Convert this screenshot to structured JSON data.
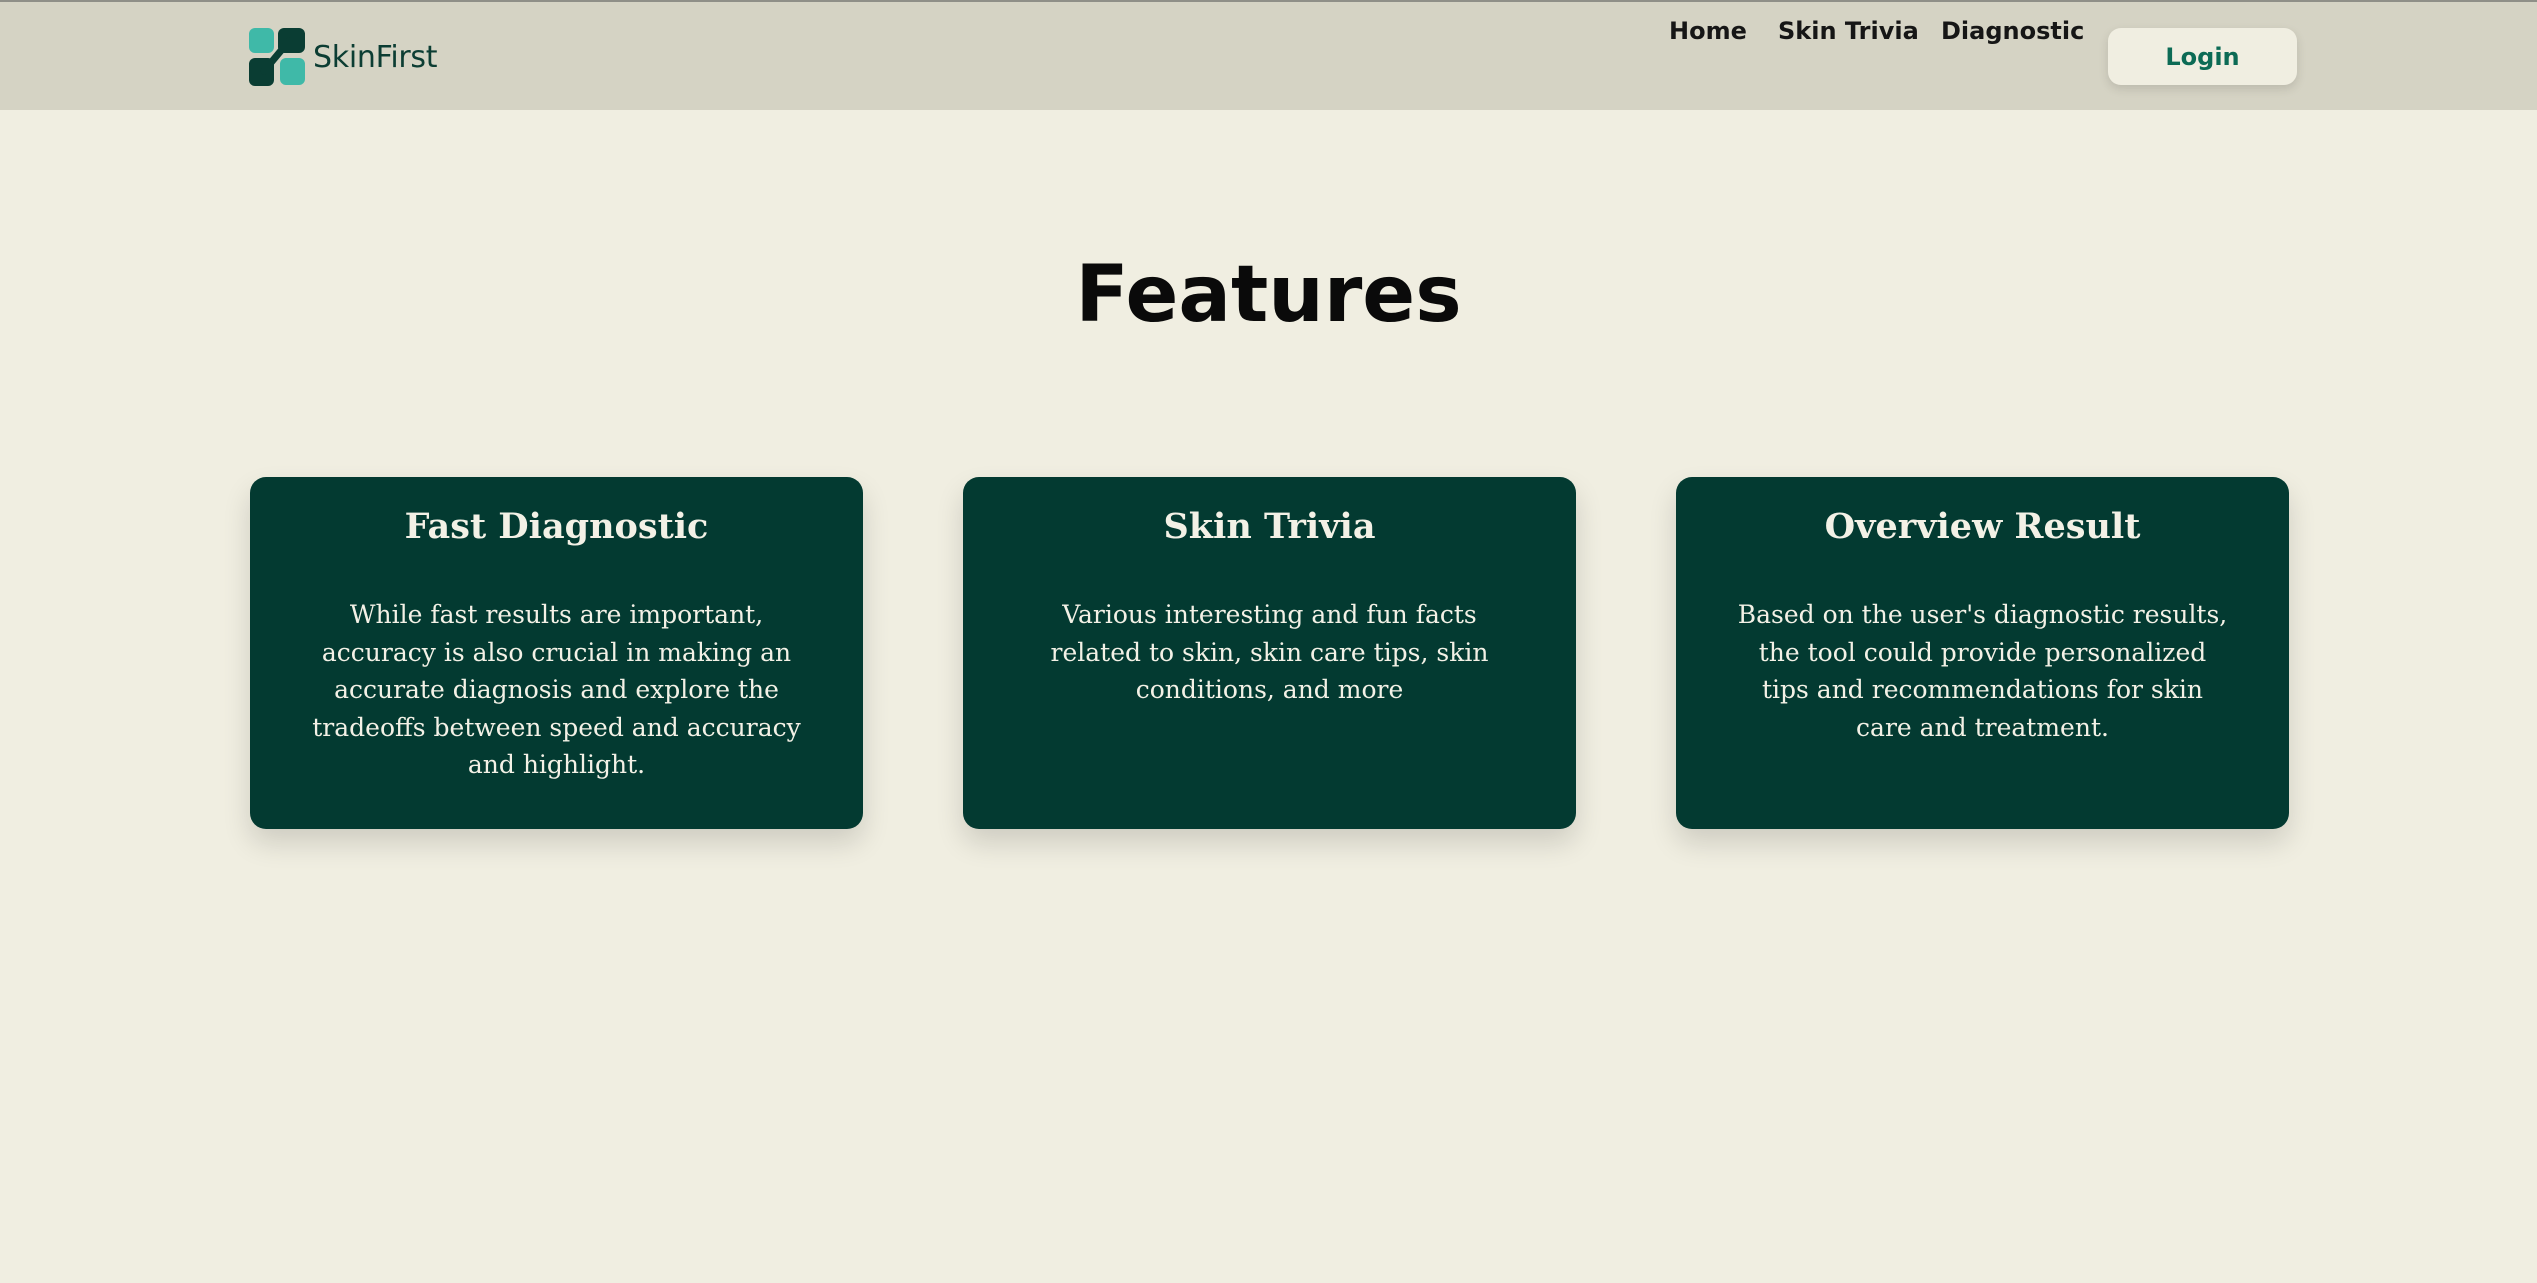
{
  "brand": {
    "name": "SkinFirst",
    "logo_icon": "skinfirst-logo-icon",
    "colors": {
      "light": "#3fb9a8",
      "dark": "#0a3d33"
    }
  },
  "nav": {
    "links": [
      "Home",
      "Skin Trivia",
      "Diagnostic"
    ],
    "login_label": "Login"
  },
  "page": {
    "title": "Features"
  },
  "features": [
    {
      "title": "Fast Diagnostic",
      "description": "While fast results are important, accuracy is also crucial in making an accurate diagnosis and explore the tradeoffs between speed and accuracy and highlight."
    },
    {
      "title": "Skin Trivia",
      "description": "Various interesting and fun facts related to skin, skin care tips, skin conditions, and more"
    },
    {
      "title": "Overview Result",
      "description": "Based on the user's diagnostic results, the tool could provide personalized tips and recommendations for skin care and treatment."
    }
  ],
  "colors": {
    "background": "#f0eee1",
    "header": "#d5d3c4",
    "card": "#033a31",
    "accent": "#0c6b55"
  }
}
